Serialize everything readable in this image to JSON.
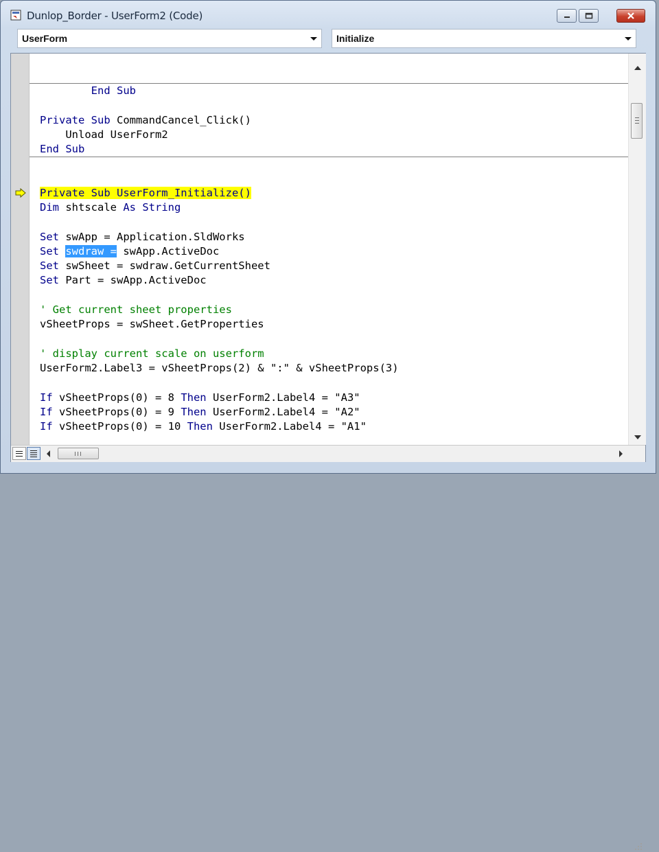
{
  "window": {
    "title": "Dunlop_Border - UserForm2 (Code)"
  },
  "dropdowns": {
    "object_value": "UserForm",
    "procedure_value": "Initialize"
  },
  "code": {
    "line_end_sub_1": "End Sub",
    "cancel_sub_decl_kw": "Private Sub ",
    "cancel_sub_decl_name": "CommandCancel_Click()",
    "unload_kw": "Unload",
    "unload_target": " UserForm2",
    "line_end_sub_2": "End Sub",
    "init_sub_decl": "Private Sub UserForm_Initialize()",
    "dim_kw": "Dim",
    "dim_name": " shtscale ",
    "dim_as": "As String",
    "set_1_rest": " swApp = Application.SldWorks",
    "set_2_selected": "swdraw =",
    "set_2_rest": " swApp.ActiveDoc",
    "set_3_rest": " swSheet = swdraw.GetCurrentSheet",
    "set_4_rest": " Part = swApp.ActiveDoc",
    "set_kw": "Set",
    "comment_1": "' Get current sheet properties",
    "props_line": "vSheetProps = swSheet.GetProperties",
    "comment_2": "' display current scale on userform",
    "label3_line": "UserForm2.Label3 = vSheetProps(2) & \":\" & vSheetProps(3)",
    "if_kw": "If",
    "then_kw": "Then",
    "if_1_cond": " vSheetProps(0) = 8 ",
    "if_1_rest": " UserForm2.Label4 = \"A3\"",
    "if_2_cond": " vSheetProps(0) = 9 ",
    "if_2_rest": " UserForm2.Label4 = \"A2\"",
    "if_3_cond": " vSheetProps(0) = 10 ",
    "if_3_rest": " UserForm2.Label4 = \"A1\""
  },
  "scrollbars": {
    "hscroll_grip": "III"
  },
  "colors": {
    "keyword": "#00008b",
    "comment": "#008000",
    "execution_highlight": "#ffff00",
    "selection": "#3399ff"
  },
  "icons": {
    "app": "vba-module-icon",
    "execution": "execution-pointer-arrow-icon",
    "minimize": "minimize-icon",
    "maximize": "maximize-icon",
    "close": "close-icon"
  }
}
